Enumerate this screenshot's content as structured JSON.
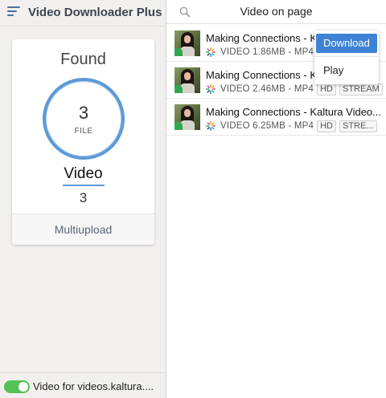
{
  "app": {
    "title": "Video Downloader Plus"
  },
  "summary": {
    "found_label": "Found",
    "count": "3",
    "unit": "FILE",
    "type_label": "Video",
    "type_count": "3",
    "multiupload_label": "Multiupload"
  },
  "footer": {
    "toggle_on": true,
    "label": "Video for videos.kaltura...."
  },
  "panel": {
    "title": "Video on page"
  },
  "videos": [
    {
      "title": "Making Connections - Kaltura Video",
      "type": "VIDEO",
      "size": "1.86MB",
      "format": "MP4",
      "tags": []
    },
    {
      "title": "Making Connections - Kaltura Video",
      "type": "VIDEO",
      "size": "2.46MB",
      "format": "MP4",
      "tags": [
        "HD",
        "STREAM"
      ]
    },
    {
      "title": "Making Connections - Kaltura Video...",
      "type": "VIDEO",
      "size": "6.25MB",
      "format": "MP4",
      "tags": [
        "HD",
        "STRE..."
      ]
    }
  ],
  "video_meta": [
    "VIDEO 1.86MB - MP4",
    "VIDEO 2.46MB - MP4",
    "VIDEO 6.25MB - MP4"
  ],
  "context_menu": {
    "download_label": "Download",
    "play_label": "Play"
  },
  "colors": {
    "accent": "#5c9ad6",
    "toggle_on": "#55c157",
    "menu_highlight": "#3d82d6"
  },
  "icons": {
    "menu": "hamburger-icon",
    "search": "search-icon",
    "loading": "spinner-icon"
  }
}
